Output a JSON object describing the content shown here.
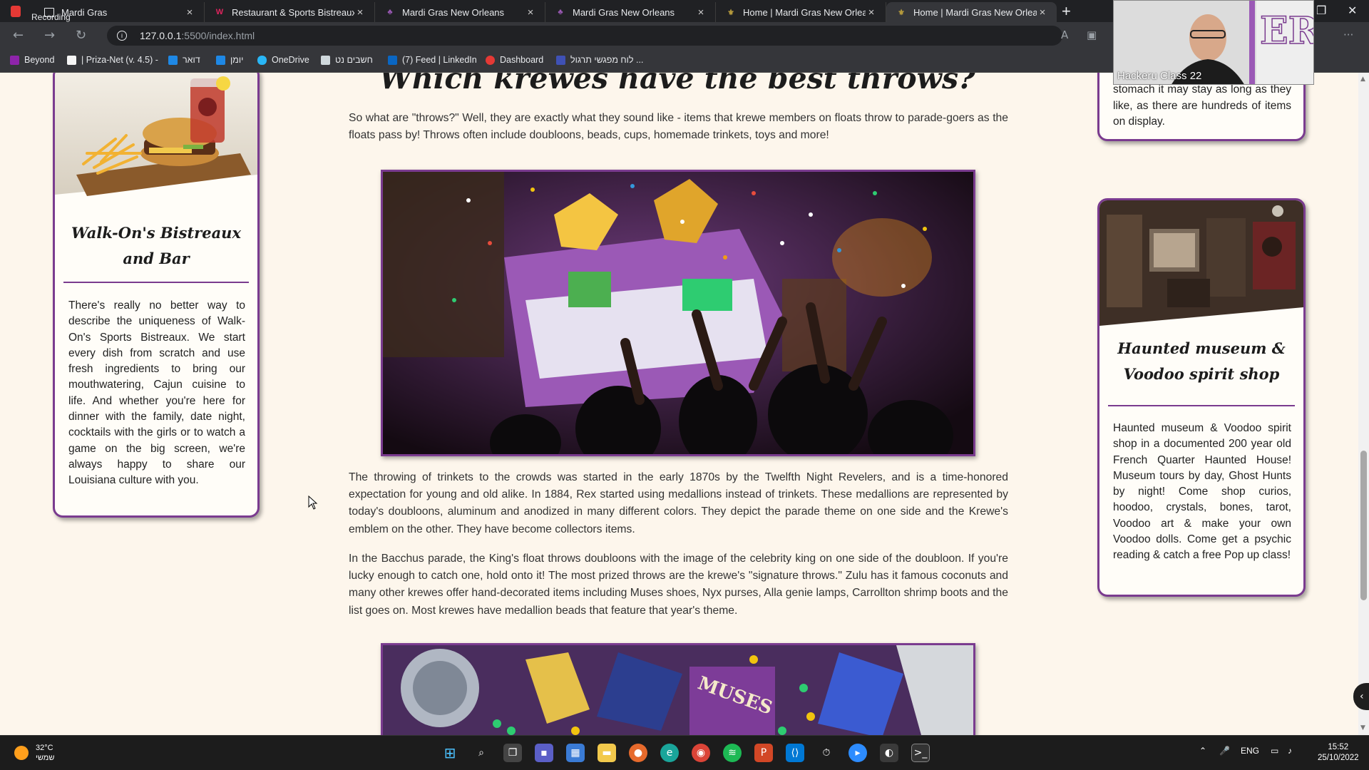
{
  "recording_label": "Recording",
  "tabs": [
    {
      "title": "Mardi Gras",
      "icon": "document-icon",
      "active": false
    },
    {
      "title": "Restaurant & Sports Bistreaux | W",
      "icon": "restaurant-icon",
      "active": false
    },
    {
      "title": "Mardi Gras New Orleans",
      "icon": "mardi-gras-icon",
      "active": false
    },
    {
      "title": "Mardi Gras New Orleans",
      "icon": "mardi-gras-icon",
      "active": false
    },
    {
      "title": "Home | Mardi Gras New Orleans",
      "icon": "home-icon",
      "active": false
    },
    {
      "title": "Home | Mardi Gras New Orleans",
      "icon": "home-icon",
      "active": true
    }
  ],
  "address": {
    "host": "127.0.0.1",
    "path": ":5500/index.html"
  },
  "bookmarks": [
    {
      "label": "Beyond",
      "color": "#8e24aa"
    },
    {
      "label": "| Priza-Net (v. 4.5) -",
      "color": "#f5f5f5"
    },
    {
      "label": "דואר",
      "color": "#1e88e5"
    },
    {
      "label": "יומן",
      "color": "#1e88e5"
    },
    {
      "label": "OneDrive",
      "color": "#29b6f6"
    },
    {
      "label": "חשבים נט",
      "color": "#cfd8dc"
    },
    {
      "label": "(7) Feed | LinkedIn",
      "color": "#0a66c2"
    },
    {
      "label": "Dashboard",
      "color": "#e53935"
    },
    {
      "label": "לוח מפגשי תרגול ...",
      "color": "#3f51b5"
    }
  ],
  "left_card": {
    "title": "Walk-On's Bistreaux and Bar",
    "text": "There's really no better way to describe the uniqueness of Walk-On's Sports Bistreaux. We start every dish from scratch and use fresh ingredients to bring our mouthwatering, Cajun cuisine to life. And whether you're here for dinner with the family, date night, cocktails with the girls or to watch a game on the big screen, we're always happy to share our Louisiana culture with you."
  },
  "right_top_card": {
    "text": "stomach it may stay as long as they like, as there are hundreds of items on display."
  },
  "right_card": {
    "title": "Haunted museum & Voodoo spirit shop",
    "text": "Haunted museum & Voodoo spirit shop in a documented 200 year old French Quarter Haunted House! Museum tours by day, Ghost Hunts by night! Come shop curios, hoodoo, crystals, bones, tarot, Voodoo art & make your own Voodoo dolls. Come get a psychic reading & catch a free Pop up class!"
  },
  "main": {
    "heading": "Which krewes have the best throws?",
    "para1": "So what are \"throws?\" Well, they are exactly what they sound like - items that krewe members on floats throw to parade-goers as the floats pass by! Throws often include doubloons, beads, cups, homemade trinkets, toys and more!",
    "para2": "The throwing of trinkets to the crowds was started in the early 1870s by the Twelfth Night Revelers, and is a time-honored expectation for young and old alike. In 1884, Rex started using medallions instead of trinkets. These medallions are represented by today's doubloons, aluminum and anodized in many different colors. They depict the parade theme on one side and the Krewe's emblem on the other. They have become collectors items.",
    "para3": "In the Bacchus parade, the King's float throws doubloons with the image of the celebrity king on one side of the doubloon. If you're lucky enough to catch one, hold onto it! The most prized throws are the krewe's \"signature throws.\" Zulu has it famous coconuts and many other krewes offer hand-decorated items including Muses shoes, Nyx purses, Alla genie lamps, Carrollton shrimp boots and the list goes on. Most krewes have medallion beads that feature that year's theme.",
    "photo2_text": "MUSES"
  },
  "webcam": {
    "label": "Hackeru Class 22"
  },
  "taskbar": {
    "temperature": "32°C",
    "weather_desc": "שמשי",
    "language": "ENG",
    "time": "15:52",
    "date": "25/10/2022"
  },
  "colors": {
    "accent": "#7a3b8f",
    "page_bg": "#fdf6ec"
  }
}
